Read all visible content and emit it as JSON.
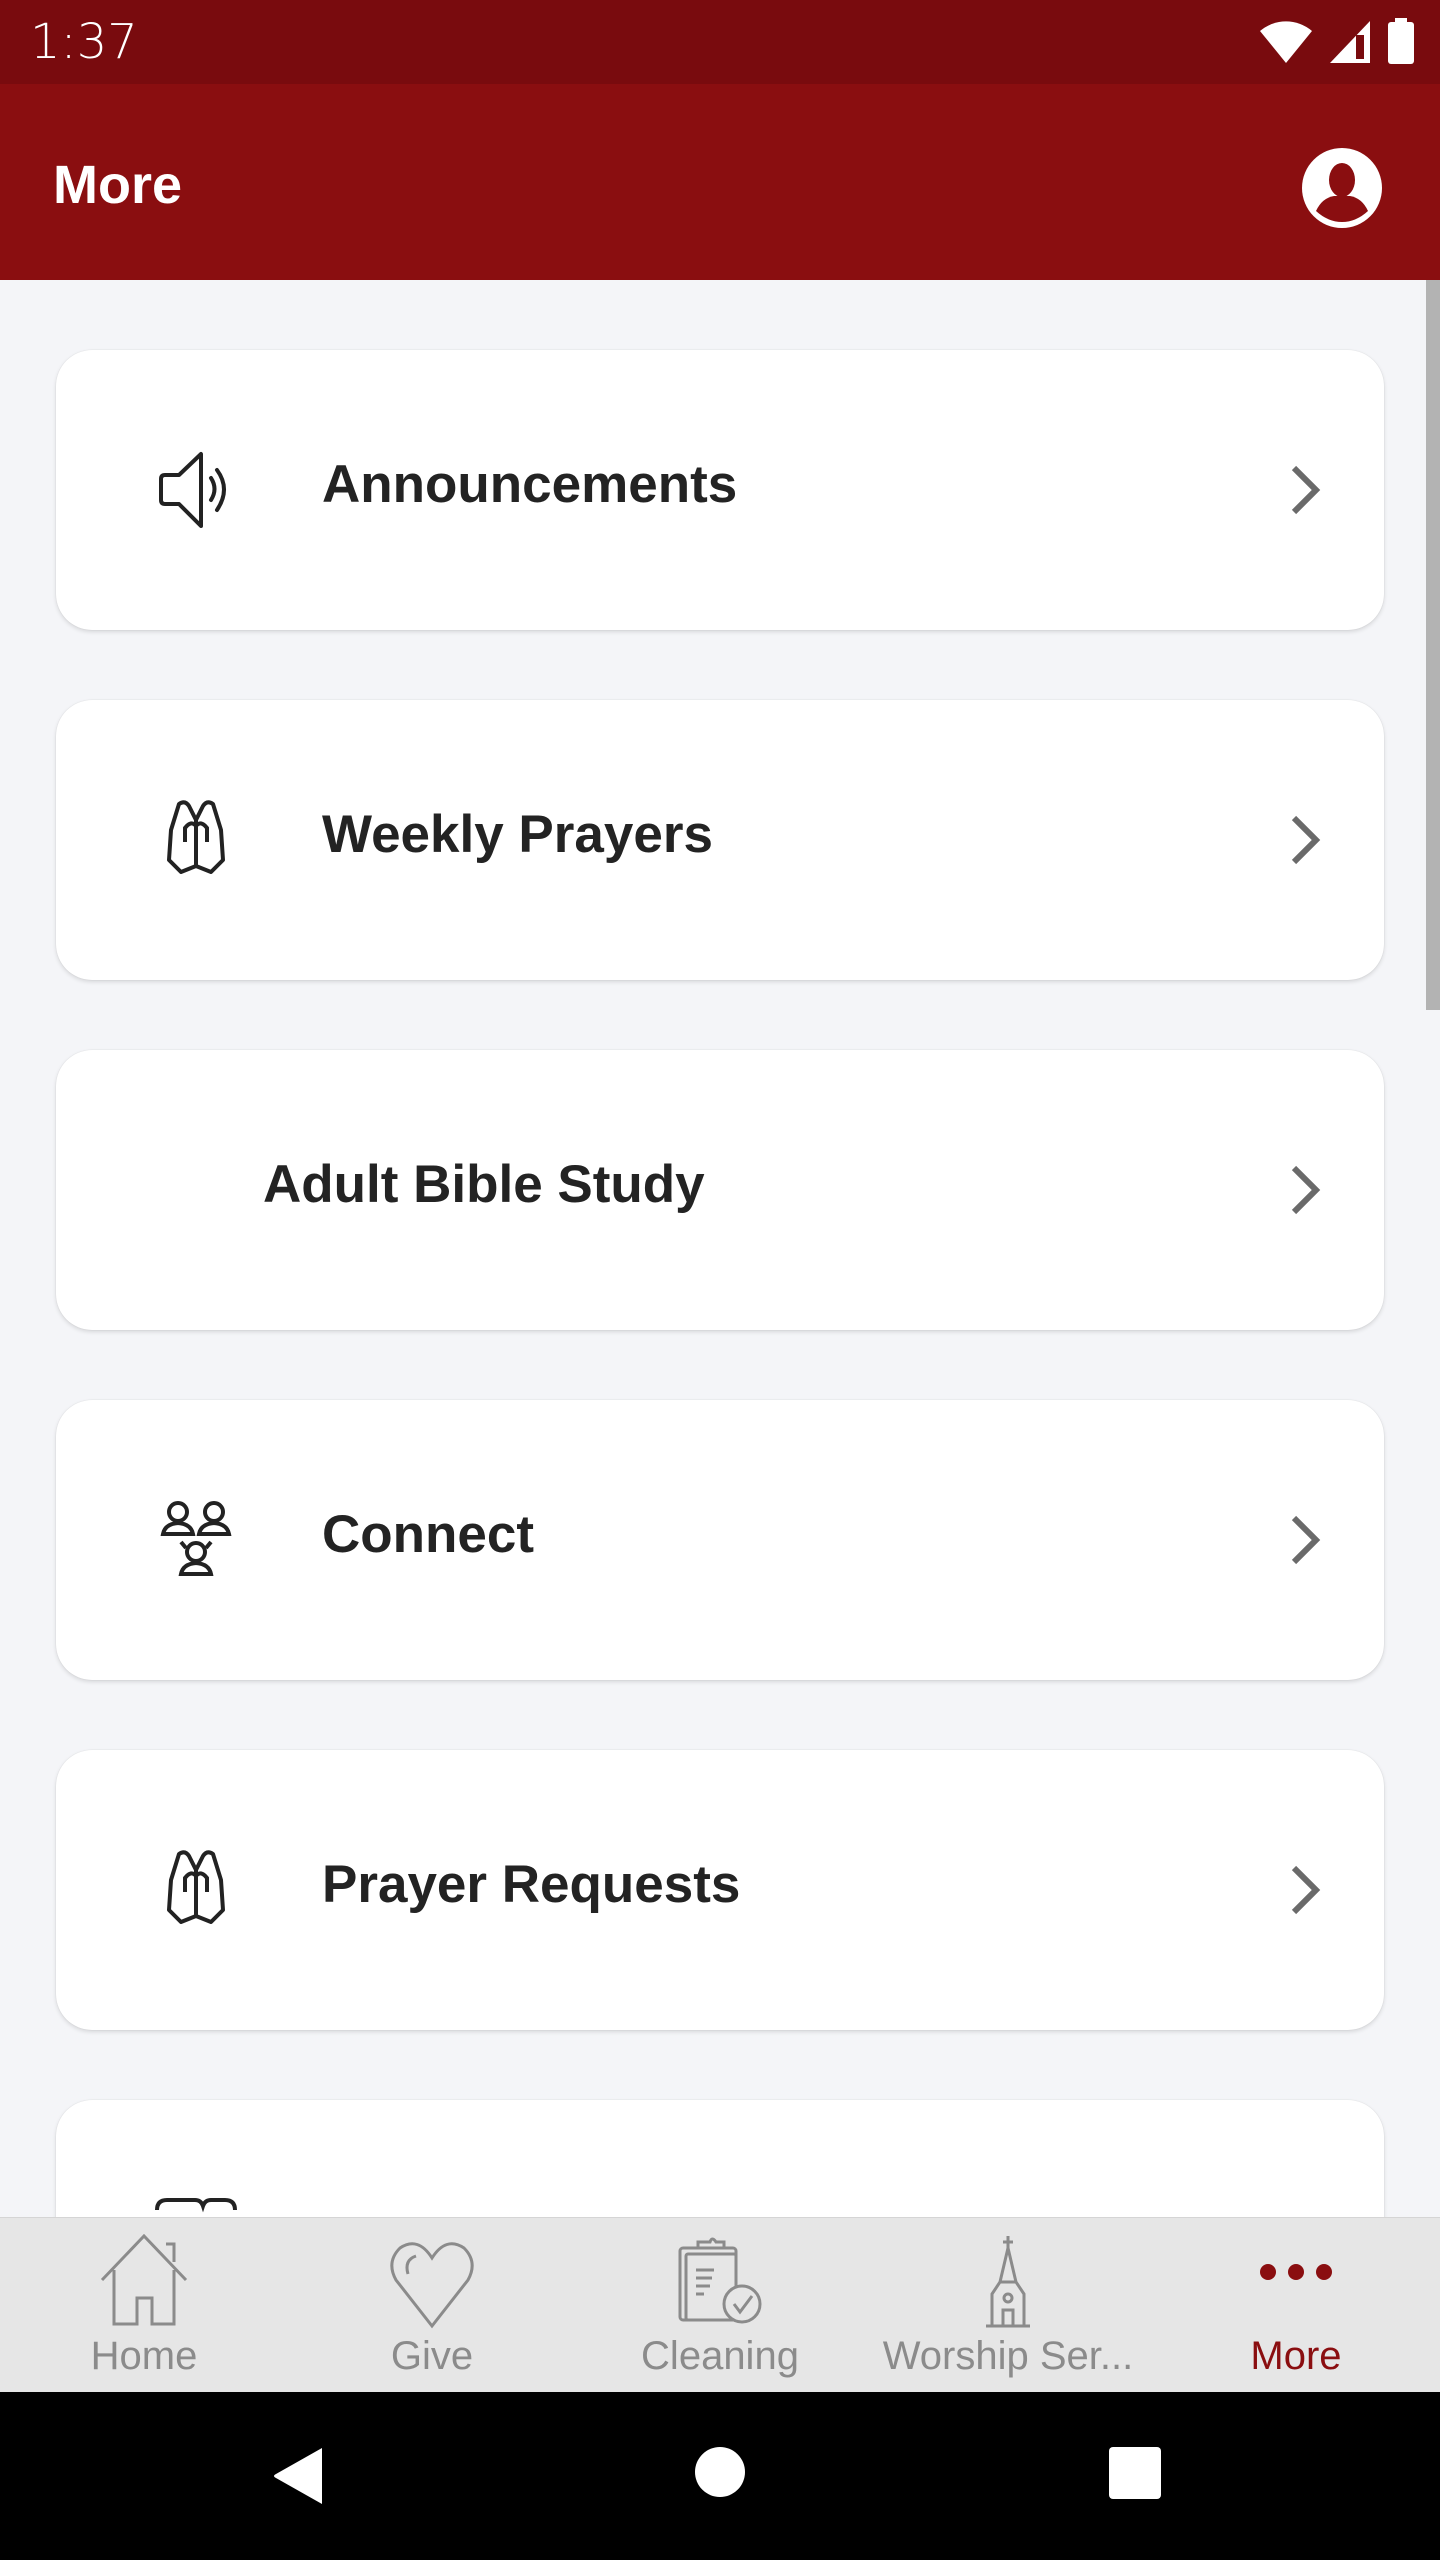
{
  "status_bar": {
    "time": "1:37",
    "icons": [
      "wifi-icon",
      "cellular-signal-icon",
      "battery-icon"
    ]
  },
  "app_bar": {
    "title": "More",
    "profile_icon": "account-circle-icon"
  },
  "menu_items": [
    {
      "label": "Announcements",
      "icon": "megaphone-speaker-icon"
    },
    {
      "label": "Weekly Prayers",
      "icon": "praying-hands-icon"
    },
    {
      "label": "Adult Bible Study",
      "icon": null
    },
    {
      "label": "Connect",
      "icon": "group-connect-icon"
    },
    {
      "label": "Prayer Requests",
      "icon": "praying-hands-icon"
    },
    {
      "label": "",
      "icon": "book-icon"
    }
  ],
  "bottom_nav": {
    "active": "More",
    "items": [
      {
        "label": "Home",
        "icon": "home-icon"
      },
      {
        "label": "Give",
        "icon": "heart-icon"
      },
      {
        "label": "Cleaning",
        "icon": "clipboard-check-icon"
      },
      {
        "label": "Worship Ser...",
        "icon": "church-icon"
      },
      {
        "label": "More",
        "icon": "more-dots-icon"
      }
    ]
  },
  "colors": {
    "status_bar": "#790b0e",
    "app_bar": "#8a0e10",
    "accent": "#8a0e10",
    "background": "#f4f5f8",
    "card": "#ffffff",
    "nav_inactive": "#8b8b8b",
    "text": "#232323"
  }
}
